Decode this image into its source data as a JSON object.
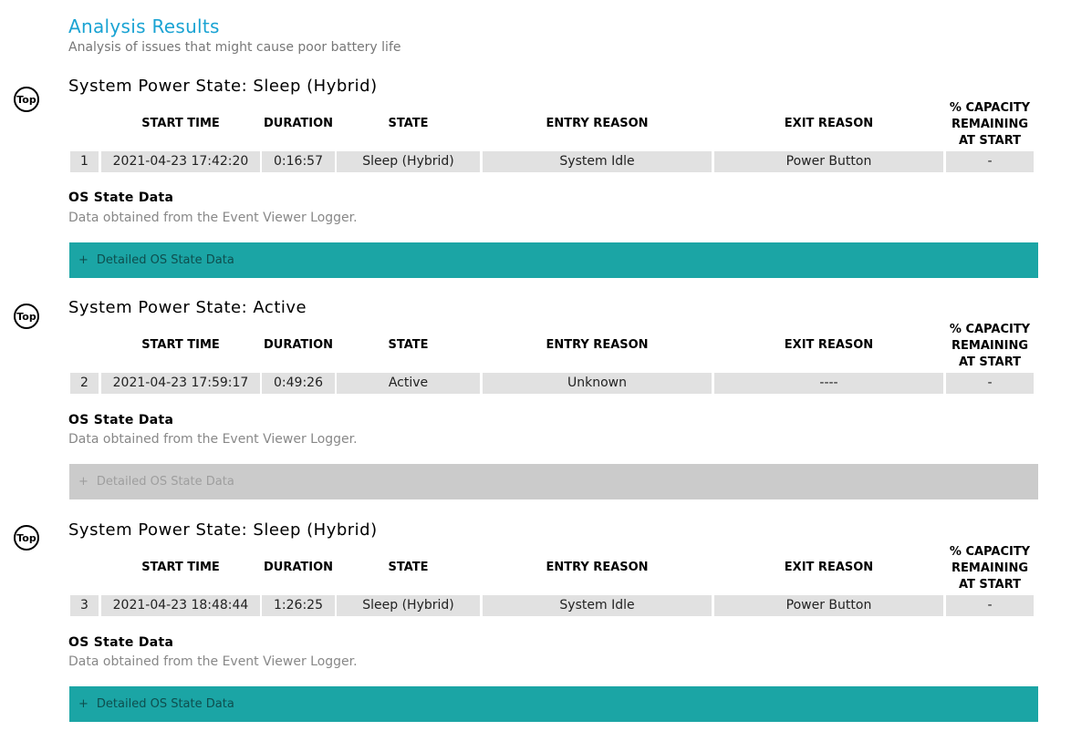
{
  "header": {
    "title": "Analysis Results",
    "subtitle": "Analysis of issues that might cause poor battery life"
  },
  "top_label": "Top",
  "columns": {
    "start_time": "START TIME",
    "duration": "DURATION",
    "state": "STATE",
    "entry_reason": "ENTRY REASON",
    "exit_reason": "EXIT REASON",
    "capacity_line1": "% CAPACITY",
    "capacity_line2": "REMAINING",
    "capacity_line3": "AT START"
  },
  "os_title": "OS State Data",
  "os_subtitle": "Data obtained from the Event Viewer Logger.",
  "detail_plus": "+",
  "detail_label": "Detailed OS State Data",
  "colors": {
    "accent_title": "#1aa3d3",
    "detail_active": "#1ba5a5",
    "detail_inactive": "#cbcbcb"
  },
  "sections": [
    {
      "title": "System Power State: Sleep (Hybrid)",
      "row": {
        "index": "1",
        "start_time": "2021-04-23  17:42:20",
        "duration": "0:16:57",
        "state": "Sleep (Hybrid)",
        "entry_reason": "System Idle",
        "exit_reason": "Power Button",
        "capacity": "-"
      },
      "detail_enabled": true
    },
    {
      "title": "System Power State: Active",
      "row": {
        "index": "2",
        "start_time": "2021-04-23  17:59:17",
        "duration": "0:49:26",
        "state": "Active",
        "entry_reason": "Unknown",
        "exit_reason": "----",
        "capacity": "-"
      },
      "detail_enabled": false
    },
    {
      "title": "System Power State: Sleep (Hybrid)",
      "row": {
        "index": "3",
        "start_time": "2021-04-23  18:48:44",
        "duration": "1:26:25",
        "state": "Sleep (Hybrid)",
        "entry_reason": "System Idle",
        "exit_reason": "Power Button",
        "capacity": "-"
      },
      "detail_enabled": true
    }
  ]
}
